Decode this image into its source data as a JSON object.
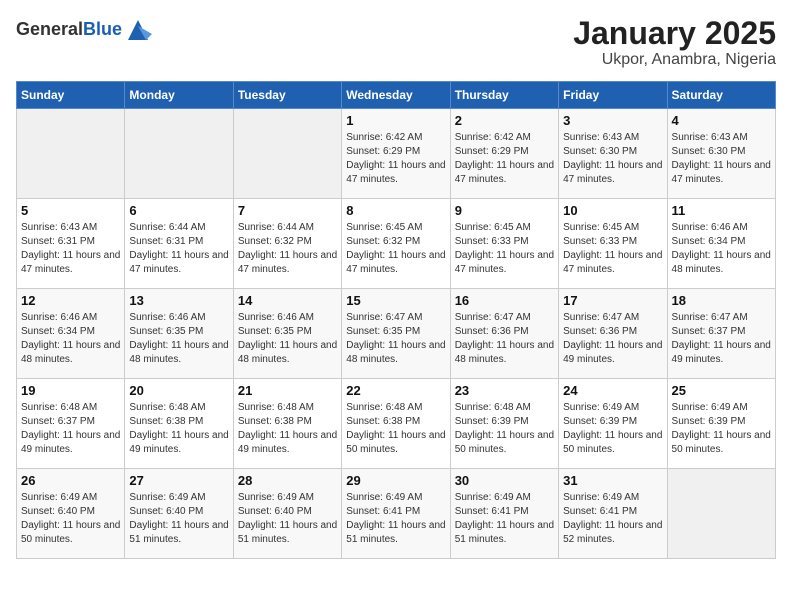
{
  "header": {
    "logo_general": "General",
    "logo_blue": "Blue",
    "title": "January 2025",
    "subtitle": "Ukpor, Anambra, Nigeria"
  },
  "weekdays": [
    "Sunday",
    "Monday",
    "Tuesday",
    "Wednesday",
    "Thursday",
    "Friday",
    "Saturday"
  ],
  "weeks": [
    [
      {
        "day": "",
        "sunrise": "",
        "sunset": "",
        "daylight": "",
        "empty": true
      },
      {
        "day": "",
        "sunrise": "",
        "sunset": "",
        "daylight": "",
        "empty": true
      },
      {
        "day": "",
        "sunrise": "",
        "sunset": "",
        "daylight": "",
        "empty": true
      },
      {
        "day": "1",
        "sunrise": "Sunrise: 6:42 AM",
        "sunset": "Sunset: 6:29 PM",
        "daylight": "Daylight: 11 hours and 47 minutes."
      },
      {
        "day": "2",
        "sunrise": "Sunrise: 6:42 AM",
        "sunset": "Sunset: 6:29 PM",
        "daylight": "Daylight: 11 hours and 47 minutes."
      },
      {
        "day": "3",
        "sunrise": "Sunrise: 6:43 AM",
        "sunset": "Sunset: 6:30 PM",
        "daylight": "Daylight: 11 hours and 47 minutes."
      },
      {
        "day": "4",
        "sunrise": "Sunrise: 6:43 AM",
        "sunset": "Sunset: 6:30 PM",
        "daylight": "Daylight: 11 hours and 47 minutes."
      }
    ],
    [
      {
        "day": "5",
        "sunrise": "Sunrise: 6:43 AM",
        "sunset": "Sunset: 6:31 PM",
        "daylight": "Daylight: 11 hours and 47 minutes."
      },
      {
        "day": "6",
        "sunrise": "Sunrise: 6:44 AM",
        "sunset": "Sunset: 6:31 PM",
        "daylight": "Daylight: 11 hours and 47 minutes."
      },
      {
        "day": "7",
        "sunrise": "Sunrise: 6:44 AM",
        "sunset": "Sunset: 6:32 PM",
        "daylight": "Daylight: 11 hours and 47 minutes."
      },
      {
        "day": "8",
        "sunrise": "Sunrise: 6:45 AM",
        "sunset": "Sunset: 6:32 PM",
        "daylight": "Daylight: 11 hours and 47 minutes."
      },
      {
        "day": "9",
        "sunrise": "Sunrise: 6:45 AM",
        "sunset": "Sunset: 6:33 PM",
        "daylight": "Daylight: 11 hours and 47 minutes."
      },
      {
        "day": "10",
        "sunrise": "Sunrise: 6:45 AM",
        "sunset": "Sunset: 6:33 PM",
        "daylight": "Daylight: 11 hours and 47 minutes."
      },
      {
        "day": "11",
        "sunrise": "Sunrise: 6:46 AM",
        "sunset": "Sunset: 6:34 PM",
        "daylight": "Daylight: 11 hours and 48 minutes."
      }
    ],
    [
      {
        "day": "12",
        "sunrise": "Sunrise: 6:46 AM",
        "sunset": "Sunset: 6:34 PM",
        "daylight": "Daylight: 11 hours and 48 minutes."
      },
      {
        "day": "13",
        "sunrise": "Sunrise: 6:46 AM",
        "sunset": "Sunset: 6:35 PM",
        "daylight": "Daylight: 11 hours and 48 minutes."
      },
      {
        "day": "14",
        "sunrise": "Sunrise: 6:46 AM",
        "sunset": "Sunset: 6:35 PM",
        "daylight": "Daylight: 11 hours and 48 minutes."
      },
      {
        "day": "15",
        "sunrise": "Sunrise: 6:47 AM",
        "sunset": "Sunset: 6:35 PM",
        "daylight": "Daylight: 11 hours and 48 minutes."
      },
      {
        "day": "16",
        "sunrise": "Sunrise: 6:47 AM",
        "sunset": "Sunset: 6:36 PM",
        "daylight": "Daylight: 11 hours and 48 minutes."
      },
      {
        "day": "17",
        "sunrise": "Sunrise: 6:47 AM",
        "sunset": "Sunset: 6:36 PM",
        "daylight": "Daylight: 11 hours and 49 minutes."
      },
      {
        "day": "18",
        "sunrise": "Sunrise: 6:47 AM",
        "sunset": "Sunset: 6:37 PM",
        "daylight": "Daylight: 11 hours and 49 minutes."
      }
    ],
    [
      {
        "day": "19",
        "sunrise": "Sunrise: 6:48 AM",
        "sunset": "Sunset: 6:37 PM",
        "daylight": "Daylight: 11 hours and 49 minutes."
      },
      {
        "day": "20",
        "sunrise": "Sunrise: 6:48 AM",
        "sunset": "Sunset: 6:38 PM",
        "daylight": "Daylight: 11 hours and 49 minutes."
      },
      {
        "day": "21",
        "sunrise": "Sunrise: 6:48 AM",
        "sunset": "Sunset: 6:38 PM",
        "daylight": "Daylight: 11 hours and 49 minutes."
      },
      {
        "day": "22",
        "sunrise": "Sunrise: 6:48 AM",
        "sunset": "Sunset: 6:38 PM",
        "daylight": "Daylight: 11 hours and 50 minutes."
      },
      {
        "day": "23",
        "sunrise": "Sunrise: 6:48 AM",
        "sunset": "Sunset: 6:39 PM",
        "daylight": "Daylight: 11 hours and 50 minutes."
      },
      {
        "day": "24",
        "sunrise": "Sunrise: 6:49 AM",
        "sunset": "Sunset: 6:39 PM",
        "daylight": "Daylight: 11 hours and 50 minutes."
      },
      {
        "day": "25",
        "sunrise": "Sunrise: 6:49 AM",
        "sunset": "Sunset: 6:39 PM",
        "daylight": "Daylight: 11 hours and 50 minutes."
      }
    ],
    [
      {
        "day": "26",
        "sunrise": "Sunrise: 6:49 AM",
        "sunset": "Sunset: 6:40 PM",
        "daylight": "Daylight: 11 hours and 50 minutes."
      },
      {
        "day": "27",
        "sunrise": "Sunrise: 6:49 AM",
        "sunset": "Sunset: 6:40 PM",
        "daylight": "Daylight: 11 hours and 51 minutes."
      },
      {
        "day": "28",
        "sunrise": "Sunrise: 6:49 AM",
        "sunset": "Sunset: 6:40 PM",
        "daylight": "Daylight: 11 hours and 51 minutes."
      },
      {
        "day": "29",
        "sunrise": "Sunrise: 6:49 AM",
        "sunset": "Sunset: 6:41 PM",
        "daylight": "Daylight: 11 hours and 51 minutes."
      },
      {
        "day": "30",
        "sunrise": "Sunrise: 6:49 AM",
        "sunset": "Sunset: 6:41 PM",
        "daylight": "Daylight: 11 hours and 51 minutes."
      },
      {
        "day": "31",
        "sunrise": "Sunrise: 6:49 AM",
        "sunset": "Sunset: 6:41 PM",
        "daylight": "Daylight: 11 hours and 52 minutes."
      },
      {
        "day": "",
        "sunrise": "",
        "sunset": "",
        "daylight": "",
        "empty": true
      }
    ]
  ]
}
